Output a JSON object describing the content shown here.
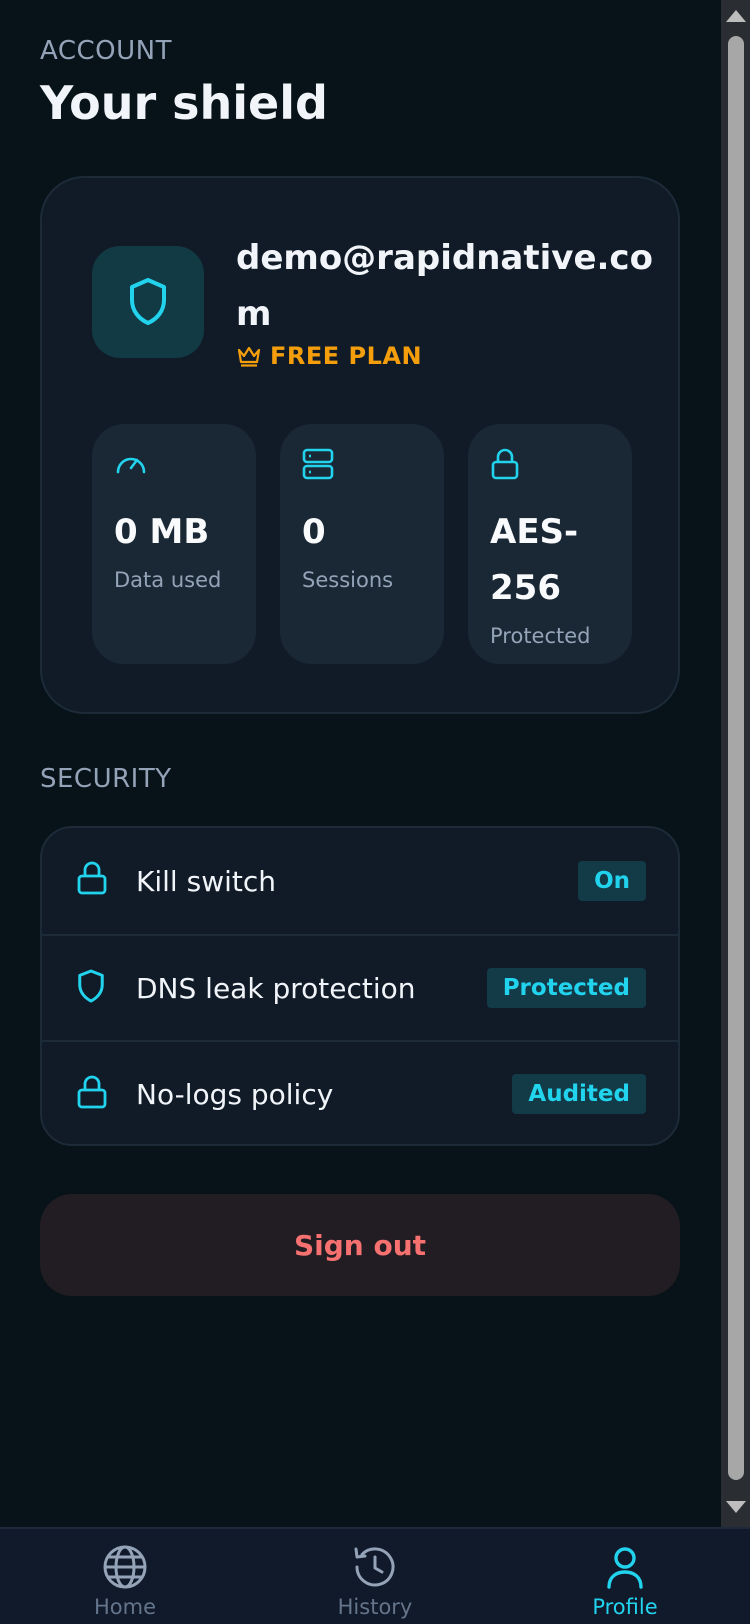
{
  "header": {
    "eyebrow": "ACCOUNT",
    "title": "Your shield"
  },
  "profile": {
    "email": "demo@rapidnative.com",
    "plan": "FREE PLAN",
    "avatar_icon": "shield-icon",
    "stats": [
      {
        "value": "0 MB",
        "label": "Data used",
        "icon": "gauge-icon"
      },
      {
        "value": "0",
        "label": "Sessions",
        "icon": "server-icon"
      },
      {
        "value": "AES-256",
        "label": "Protected",
        "icon": "lock-icon"
      }
    ]
  },
  "security": {
    "label": "SECURITY",
    "items": [
      {
        "label": "Kill switch",
        "status": "On",
        "icon": "lock-icon"
      },
      {
        "label": "DNS leak protection",
        "status": "Protected",
        "icon": "shield-icon"
      },
      {
        "label": "No-logs policy",
        "status": "Audited",
        "icon": "lock-icon"
      }
    ]
  },
  "actions": {
    "signout": "Sign out"
  },
  "tabbar": {
    "tabs": [
      {
        "label": "Home",
        "icon": "globe-icon",
        "active": false
      },
      {
        "label": "History",
        "icon": "history-icon",
        "active": false
      },
      {
        "label": "Profile",
        "icon": "user-icon",
        "active": true
      }
    ]
  },
  "colors": {
    "background": "#071219",
    "card": "#101b27",
    "accent": "#22d3ee",
    "plan": "#f59e0b",
    "danger": "#f87171"
  }
}
